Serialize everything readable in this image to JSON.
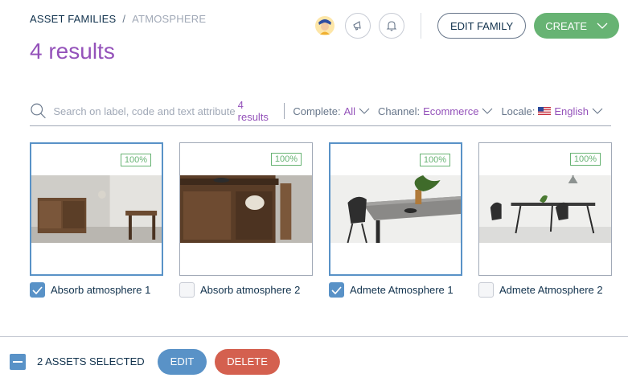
{
  "breadcrumb": {
    "root": "Asset families",
    "separator": "/",
    "current": "Atmosphere"
  },
  "title": "4 results",
  "header": {
    "edit_family_label": "Edit family",
    "create_label": "Create"
  },
  "filters": {
    "search_placeholder": "Search on label, code and text attributes",
    "result_count": "4 results",
    "complete": {
      "label": "Complete:",
      "value": "All"
    },
    "channel": {
      "label": "Channel:",
      "value": "Ecommerce"
    },
    "locale": {
      "label": "Locale:",
      "value": "English",
      "flag": "us-flag-icon"
    }
  },
  "assets": [
    {
      "label": "Absorb atmosphere 1",
      "completeness": "100%",
      "selected": true
    },
    {
      "label": "Absorb atmosphere 2",
      "completeness": "100%",
      "selected": false
    },
    {
      "label": "Admete Atmosphere 1",
      "completeness": "100%",
      "selected": true
    },
    {
      "label": "Admete Atmosphere 2",
      "completeness": "100%",
      "selected": false
    }
  ],
  "bulk": {
    "selected_label": "2 assets selected",
    "edit_label": "Edit",
    "delete_label": "Delete"
  },
  "colors": {
    "accent_purple": "#9452ba",
    "success_green": "#67b373",
    "selection_blue": "#5992c7",
    "danger_red": "#d4604f"
  }
}
